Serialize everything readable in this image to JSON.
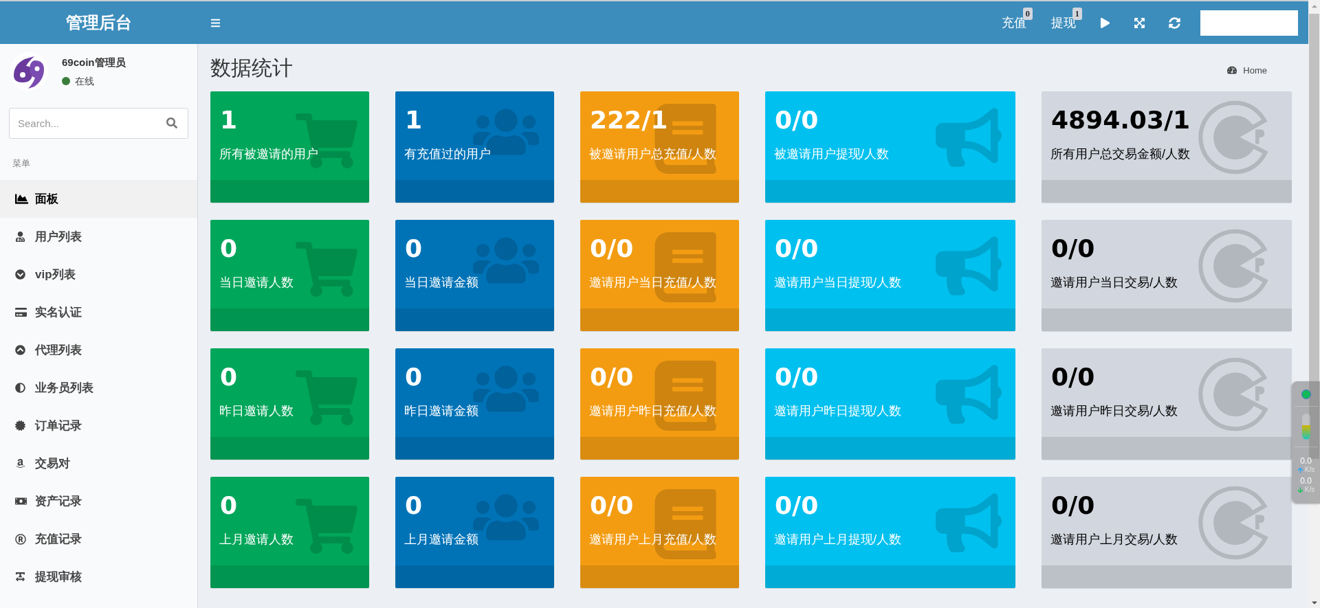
{
  "header": {
    "title": "管理后台",
    "links": [
      {
        "label": "充值",
        "badge": "0"
      },
      {
        "label": "提现",
        "badge": "1"
      }
    ]
  },
  "sidebar": {
    "user": {
      "name": "69coin管理员",
      "status": "在线",
      "online": true
    },
    "search": {
      "placeholder": "Search..."
    },
    "menu_label": "菜单",
    "items": [
      {
        "label": "面板",
        "selected": true
      },
      {
        "label": "用户列表",
        "selected": false
      },
      {
        "label": "vip列表",
        "selected": false
      },
      {
        "label": "实名认证",
        "selected": false
      },
      {
        "label": "代理列表",
        "selected": false
      },
      {
        "label": "业务员列表",
        "selected": false
      },
      {
        "label": "订单记录",
        "selected": false
      },
      {
        "label": "交易对",
        "selected": false
      },
      {
        "label": "资产记录",
        "selected": false
      },
      {
        "label": "充值记录",
        "selected": false
      },
      {
        "label": "提现审核",
        "selected": false
      }
    ]
  },
  "content": {
    "title": "数据统计",
    "breadcrumb": "Home",
    "stat_rows": [
      [
        {
          "kind": "cart",
          "value": "1",
          "caption": "所有被邀请的用户"
        },
        {
          "kind": "users",
          "value": "1",
          "caption": "有充值过的用户"
        },
        {
          "kind": "book",
          "value": "222/1",
          "caption": "被邀请用户总充值/人数"
        },
        {
          "kind": "bullhorn",
          "value": "0/0",
          "caption": "被邀请用户提现/人数"
        },
        {
          "kind": "pie",
          "value": "4894.03/1",
          "caption": "所有用户总交易金额/人数"
        }
      ],
      [
        {
          "kind": "cart",
          "value": "0",
          "caption": "当日邀请人数"
        },
        {
          "kind": "users",
          "value": "0",
          "caption": "当日邀请金额"
        },
        {
          "kind": "book",
          "value": "0/0",
          "caption": "邀请用户当日充值/人数"
        },
        {
          "kind": "bullhorn",
          "value": "0/0",
          "caption": "邀请用户当日提现/人数"
        },
        {
          "kind": "pie",
          "value": "0/0",
          "caption": "邀请用户当日交易/人数"
        }
      ],
      [
        {
          "kind": "cart",
          "value": "0",
          "caption": "昨日邀请人数"
        },
        {
          "kind": "users",
          "value": "0",
          "caption": "昨日邀请金额"
        },
        {
          "kind": "book",
          "value": "0/0",
          "caption": "邀请用户昨日充值/人数"
        },
        {
          "kind": "bullhorn",
          "value": "0/0",
          "caption": "邀请用户昨日提现/人数"
        },
        {
          "kind": "pie",
          "value": "0/0",
          "caption": "邀请用户昨日交易/人数"
        }
      ],
      [
        {
          "kind": "cart",
          "value": "0",
          "caption": "上月邀请人数"
        },
        {
          "kind": "users",
          "value": "0",
          "caption": "上月邀请金额"
        },
        {
          "kind": "book",
          "value": "0/0",
          "caption": "邀请用户上月充值/人数"
        },
        {
          "kind": "bullhorn",
          "value": "0/0",
          "caption": "邀请用户上月提现/人数"
        },
        {
          "kind": "pie",
          "value": "0/0",
          "caption": "邀请用户上月交易/人数"
        }
      ]
    ]
  },
  "speed_monitor": {
    "online": true,
    "level": 0.55,
    "rates": [
      {
        "kind": "upload",
        "value": "0.0",
        "unit": "K/s"
      },
      {
        "kind": "download",
        "value": "0.0",
        "unit": "K/s"
      }
    ]
  }
}
